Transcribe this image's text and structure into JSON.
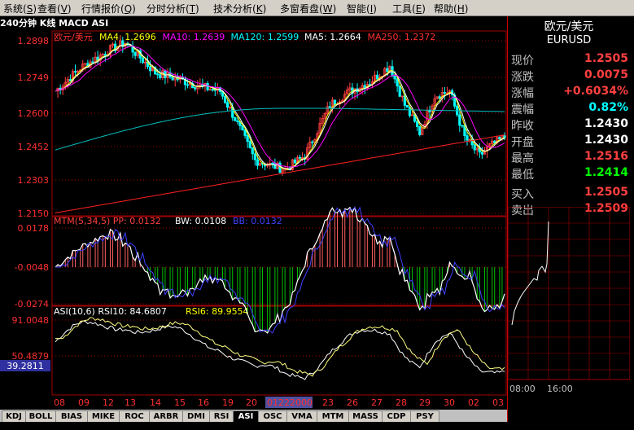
{
  "menu": [
    {
      "label": "系统",
      "key": "S"
    },
    {
      "label": "查看",
      "key": "V"
    },
    {
      "label": "行情报价",
      "key": "Q"
    },
    {
      "label": "分时分析",
      "key": "T"
    },
    {
      "label": "技术分析",
      "key": "K"
    },
    {
      "label": "多窗看盘",
      "key": "W"
    },
    {
      "label": "智能",
      "key": "I"
    },
    {
      "label": "工具",
      "key": "E"
    },
    {
      "label": "帮助",
      "key": "H"
    }
  ],
  "chart_title": "240分钟 K线 MACD ASI",
  "main_panel": {
    "name": "欧元/美元",
    "legend": [
      {
        "label": "MA4: 1.2696",
        "color": "#ffff00"
      },
      {
        "label": "MA10: 1.2639",
        "color": "#ff00ff"
      },
      {
        "label": "MA120: 1.2599",
        "color": "#00ffff"
      },
      {
        "label": "MA5: 1.2664",
        "color": "#ffffff"
      },
      {
        "label": "MA250: 1.2372",
        "color": "#ff3030"
      }
    ],
    "y_ticks": [
      "1.2898",
      "1.2749",
      "1.2600",
      "1.2452",
      "1.2303",
      "1.2150"
    ]
  },
  "mtm_panel": {
    "legend": [
      {
        "label": "MTM(5,34,5) PP: 0.0132",
        "color": "#ff4040"
      },
      {
        "label": "BW: 0.0108",
        "color": "#ffffff"
      },
      {
        "label": "BB: 0.0132",
        "color": "#4040ff"
      }
    ],
    "y_ticks": [
      "0.0178",
      "-0.0048",
      "-0.0274"
    ]
  },
  "asi_panel": {
    "legend": [
      {
        "label": "ASI(10,6) RSI10: 84.6807",
        "color": "#ffffff"
      },
      {
        "label": "RSI6: 89.9554",
        "color": "#ffff00"
      }
    ],
    "y_ticks": [
      "91.0048",
      "50.4879"
    ],
    "cursor_value": "39.2811"
  },
  "x_axis": [
    "08",
    "09",
    "12",
    "13",
    "14",
    "15",
    "16",
    "19",
    "20",
    "01222000",
    "23",
    "26",
    "27",
    "28",
    "29",
    "30",
    "02",
    "03"
  ],
  "quote": {
    "title": "欧元/美元",
    "code": "EURUSD",
    "rows": [
      {
        "label": "现价",
        "value": "1.2505",
        "color": "#ff4040"
      },
      {
        "label": "涨跌",
        "value": "0.0075",
        "color": "#ff4040"
      },
      {
        "label": "涨幅",
        "value": "+0.6034%",
        "color": "#ff4040"
      },
      {
        "label": "震幅",
        "value": "0.82%",
        "color": "#00ffff"
      },
      {
        "label": "昨收",
        "value": "1.2430",
        "color": "#ffffff"
      },
      {
        "label": "开盘",
        "value": "1.2430",
        "color": "#ffffff"
      },
      {
        "label": "最高",
        "value": "1.2516",
        "color": "#ff4040"
      },
      {
        "label": "最低",
        "value": "1.2414",
        "color": "#00ff00"
      },
      {
        "label": "买入",
        "value": "1.2505",
        "color": "#ff4040"
      },
      {
        "label": "卖出",
        "value": "1.2509",
        "color": "#ff4040"
      }
    ],
    "time_labels": [
      "08:00",
      "16:00"
    ]
  },
  "tabs": [
    "KDJ",
    "BOLL",
    "BIAS",
    "MIKE",
    "ROC",
    "ARBR",
    "DMI",
    "RSI",
    "ASI",
    "OSC",
    "VMA",
    "MTM",
    "MASS",
    "CDP",
    "PSY"
  ],
  "active_tab": "ASI",
  "colors": {
    "up": "#ff4040",
    "down": "#00ffff",
    "grid": "#a00000",
    "accent": "#ff0000"
  }
}
